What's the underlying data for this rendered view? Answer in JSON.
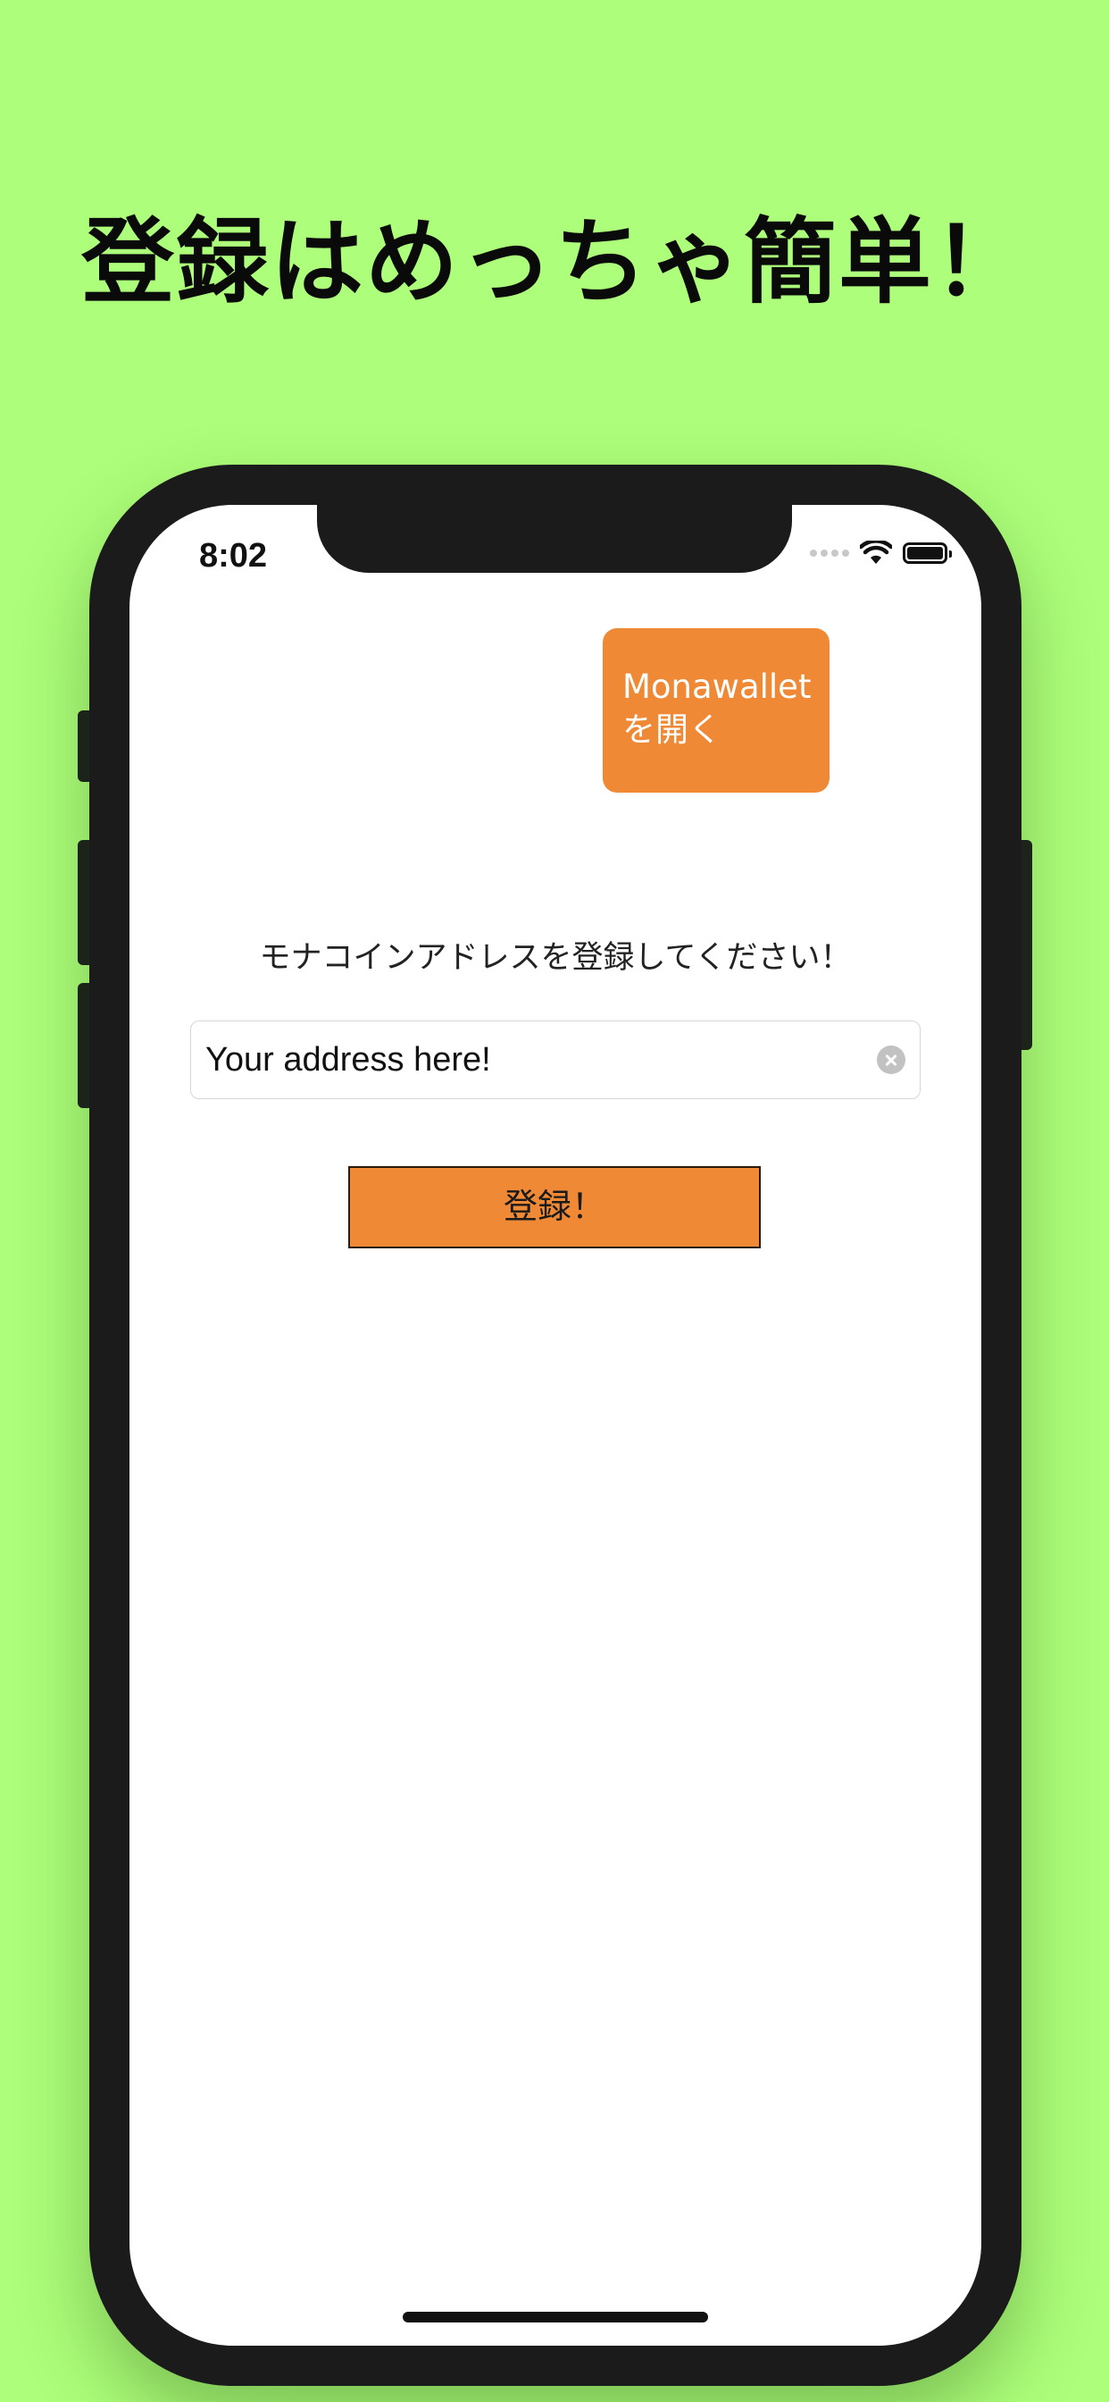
{
  "headline": "登録はめっちゃ簡単！",
  "colors": {
    "background": "#adfe7a",
    "accent": "#ef8935",
    "phone_frame": "#1b1b1b"
  },
  "status_bar": {
    "time": "8:02",
    "icons": [
      "cellular-signal-icon",
      "wifi-icon",
      "battery-icon"
    ]
  },
  "open_wallet_button": {
    "line1": "Monawallet",
    "line2": "を開く"
  },
  "address_prompt": "モナコインアドレスを登録してください！",
  "address_input": {
    "value": "Your address here!",
    "placeholder": ""
  },
  "register_button": {
    "label": "登録！"
  }
}
